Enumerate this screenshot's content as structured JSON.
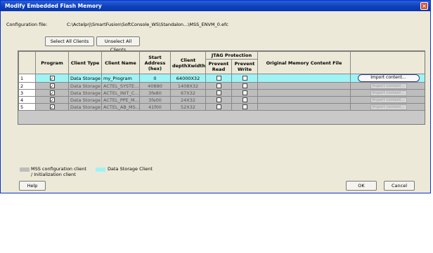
{
  "window": {
    "title": "Modify Embedded Flash Memory",
    "close_glyph": "×"
  },
  "config": {
    "label": "Configuration file:",
    "path": "C:\\Actelprj\\SmartFusion\\SoftConsole_WS\\Standalon...\\MSS_ENVM_0.efc"
  },
  "toolbar": {
    "select_all": "Select All Clients",
    "unselect_all": "Unselect All Clients"
  },
  "table": {
    "headers": {
      "program": "Program",
      "client_type": "Client Type",
      "client_name": "Client Name",
      "start_address": "Start Address (hex)",
      "client_depth": "Client depthXwidth",
      "jtag": "JTAG Protection",
      "prevent_read": "Prevent Read",
      "prevent_write": "Prevent Write",
      "original_file": "Original Memory Content File"
    },
    "rows": [
      {
        "index": "1",
        "program": true,
        "type": "Data Storage",
        "name": "my_Program",
        "address": "0",
        "depth": "64000X32",
        "read": false,
        "write": false,
        "file": "",
        "import": "Import content...",
        "selected": true
      },
      {
        "index": "2",
        "program": true,
        "type": "Data Storage",
        "name": "ACTEL_SYSTE...",
        "address": "40880",
        "depth": "1408X32",
        "read": false,
        "write": false,
        "file": "",
        "import": "Import content...",
        "selected": false
      },
      {
        "index": "3",
        "program": true,
        "type": "Data Storage",
        "name": "ACTEL_INIT_C...",
        "address": "3fe80",
        "depth": "67X32",
        "read": false,
        "write": false,
        "file": "",
        "import": "Import content...",
        "selected": false
      },
      {
        "index": "4",
        "program": true,
        "type": "Data Storage",
        "name": "ACTEL_PPE_M...",
        "address": "3fe00",
        "depth": "24X32",
        "read": false,
        "write": false,
        "file": "",
        "import": "Import content...",
        "selected": false
      },
      {
        "index": "5",
        "program": true,
        "type": "Data Storage",
        "name": "ACTEL_AB_MS...",
        "address": "41f00",
        "depth": "52X32",
        "read": false,
        "write": false,
        "file": "",
        "import": "Import content...",
        "selected": false
      }
    ]
  },
  "legend": {
    "mss": "MSS configuration client / Initialization client",
    "data": "Data Storage Client",
    "mss_color": "#bdbdbd",
    "data_color": "#9ff3f5"
  },
  "footer": {
    "help": "Help",
    "ok": "OK",
    "cancel": "Cancel"
  }
}
